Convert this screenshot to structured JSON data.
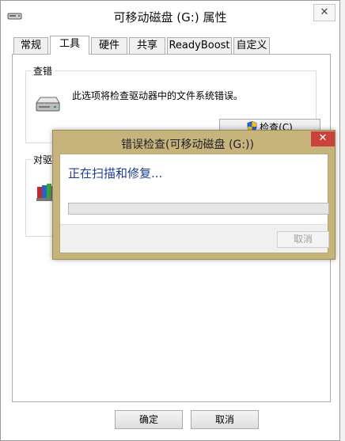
{
  "window": {
    "title": "可移动磁盘 (G:) 属性",
    "close_label": "✕"
  },
  "tabs": [
    {
      "label": "常规"
    },
    {
      "label": "工具"
    },
    {
      "label": "硬件"
    },
    {
      "label": "共享"
    },
    {
      "label": "ReadyBoost"
    },
    {
      "label": "自定义"
    }
  ],
  "active_tab": "工具",
  "check_group": {
    "title": "查错",
    "description": "此选项将检查驱动器中的文件系统错误。",
    "button_label": "检查(C)"
  },
  "optimize_group": {
    "title": "对驱动"
  },
  "footer": {
    "ok_label": "确定",
    "cancel_label": "取消"
  },
  "dialog": {
    "title": "错误检查(可移动磁盘 (G:))",
    "close_label": "✕",
    "status_text": "正在扫描和修复...",
    "progress_fraction": 0.0,
    "cancel_label": "取消",
    "cancel_enabled": false
  },
  "colors": {
    "dialog_frame": "#c7b37c",
    "dialog_close": "#c9423e",
    "status_text": "#1e3c9a",
    "progress_fill": "#06b025"
  },
  "icons": [
    "drive-icon",
    "shield-icon",
    "defrag-icon",
    "close-icon",
    "removable-drive-icon"
  ]
}
